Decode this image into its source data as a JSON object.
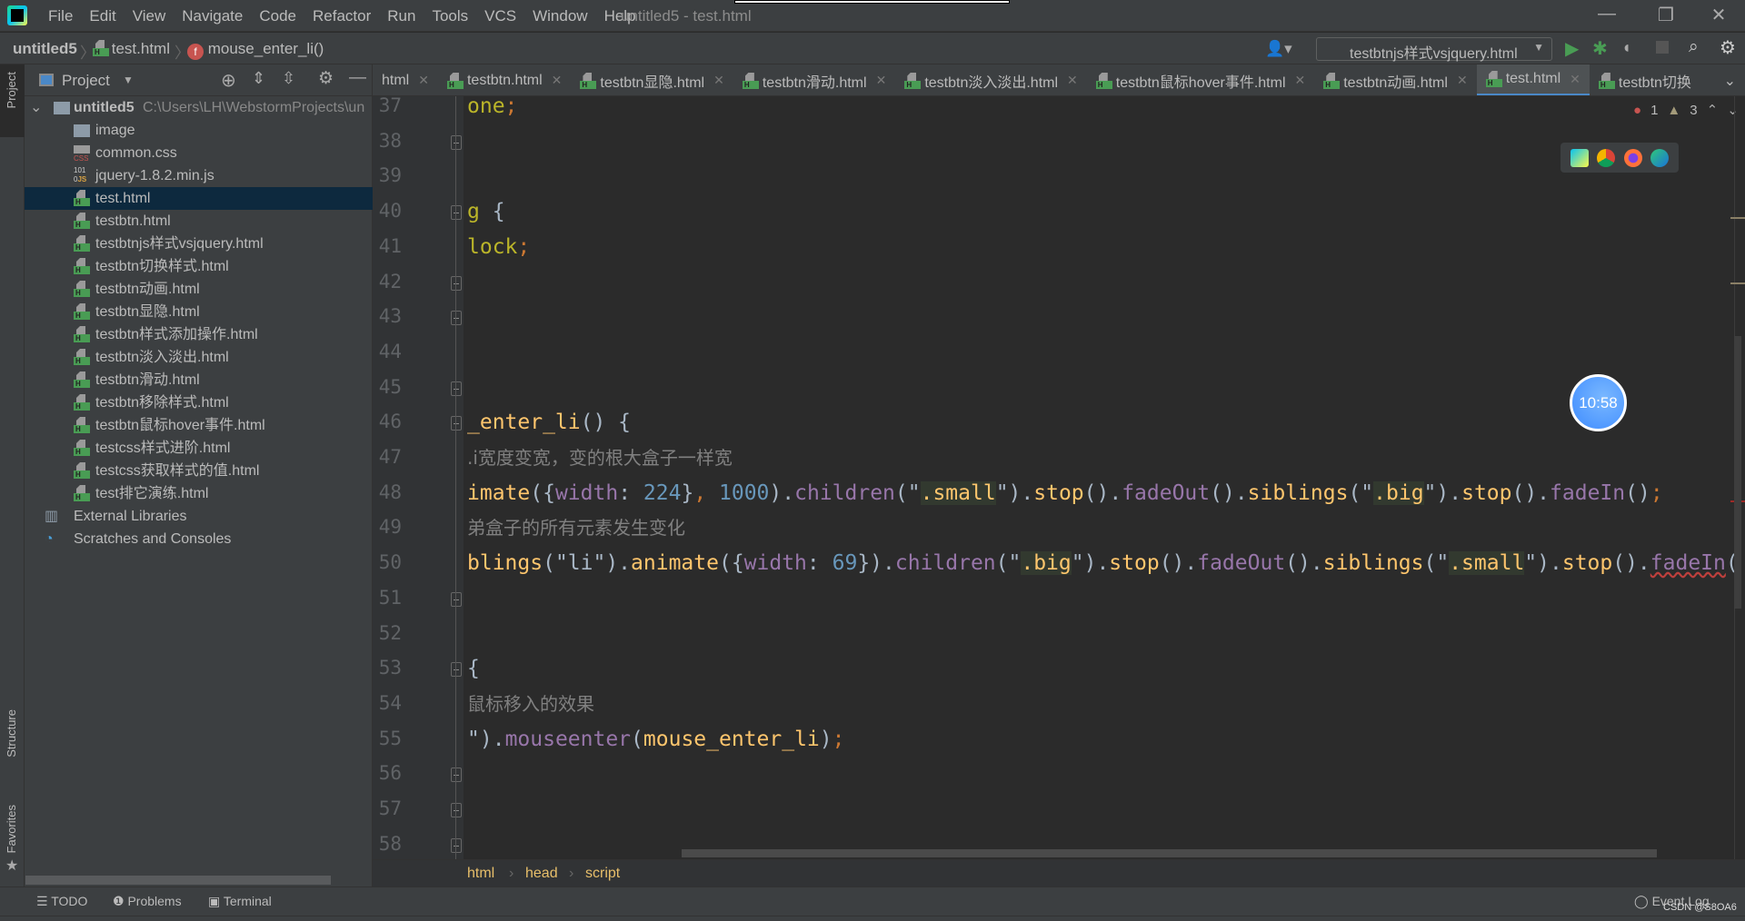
{
  "window": {
    "title": "untitled5 - test.html",
    "minimize": "—",
    "restore": "❐",
    "close": "✕"
  },
  "menu": [
    "File",
    "Edit",
    "View",
    "Navigate",
    "Code",
    "Refactor",
    "Run",
    "Tools",
    "VCS",
    "Window",
    "Help"
  ],
  "navbar": {
    "project": "untitled5",
    "file": "test.html",
    "function": "mouse_enter_li()",
    "run_config": "testbtnjs样式vsjquery.html"
  },
  "project_panel": {
    "title": "Project",
    "root": {
      "name": "untitled5",
      "path": "C:\\Users\\LH\\WebstormProjects\\un"
    },
    "items": [
      {
        "name": "image",
        "type": "folder"
      },
      {
        "name": "common.css",
        "type": "css"
      },
      {
        "name": "jquery-1.8.2.min.js",
        "type": "js"
      },
      {
        "name": "test.html",
        "type": "html",
        "selected": true
      },
      {
        "name": "testbtn.html",
        "type": "html"
      },
      {
        "name": "testbtnjs样式vsjquery.html",
        "type": "html"
      },
      {
        "name": "testbtn切换样式.html",
        "type": "html"
      },
      {
        "name": "testbtn动画.html",
        "type": "html"
      },
      {
        "name": "testbtn显隐.html",
        "type": "html"
      },
      {
        "name": "testbtn样式添加操作.html",
        "type": "html"
      },
      {
        "name": "testbtn淡入淡出.html",
        "type": "html"
      },
      {
        "name": "testbtn滑动.html",
        "type": "html"
      },
      {
        "name": "testbtn移除样式.html",
        "type": "html"
      },
      {
        "name": "testbtn鼠标hover事件.html",
        "type": "html"
      },
      {
        "name": "testcss样式进阶.html",
        "type": "html"
      },
      {
        "name": "testcss获取样式的值.html",
        "type": "html"
      },
      {
        "name": "test排它演练.html",
        "type": "html"
      }
    ],
    "external": "External Libraries",
    "scratches": "Scratches and Consoles"
  },
  "side_tabs": {
    "project": "Project",
    "structure": "Structure",
    "favorites": "Favorites"
  },
  "tabs": [
    {
      "label": "html",
      "active": false
    },
    {
      "label": "testbtn.html",
      "active": false
    },
    {
      "label": "testbtn显隐.html",
      "active": false
    },
    {
      "label": "testbtn滑动.html",
      "active": false
    },
    {
      "label": "testbtn淡入淡出.html",
      "active": false
    },
    {
      "label": "testbtn鼠标hover事件.html",
      "active": false
    },
    {
      "label": "testbtn动画.html",
      "active": false
    },
    {
      "label": "test.html",
      "active": true
    },
    {
      "label": "testbtn切换",
      "active": false
    }
  ],
  "inspections": {
    "errors": "1",
    "warnings": "3"
  },
  "clock": "10:58",
  "editor": {
    "lines": [
      {
        "n": "37",
        "fold": false,
        "t": [
          [
            "one",
            "g"
          ],
          [
            ";",
            "p"
          ]
        ]
      },
      {
        "n": "38",
        "fold": true,
        "t": []
      },
      {
        "n": "39",
        "fold": false,
        "t": []
      },
      {
        "n": "40",
        "fold": true,
        "t": [
          [
            "g",
            "g"
          ],
          [
            " {",
            "k"
          ]
        ]
      },
      {
        "n": "41",
        "fold": false,
        "t": [
          [
            "lock",
            "g"
          ],
          [
            ";",
            "p"
          ]
        ]
      },
      {
        "n": "42",
        "fold": true,
        "t": []
      },
      {
        "n": "43",
        "fold": true,
        "t": []
      },
      {
        "n": "44",
        "fold": false,
        "t": []
      },
      {
        "n": "45",
        "fold": true,
        "t": []
      },
      {
        "n": "46",
        "fold": true,
        "t": [
          [
            "_enter_li",
            "f"
          ],
          [
            "() {",
            "k"
          ]
        ]
      },
      {
        "n": "47",
        "fold": false,
        "t": [
          [
            ".i宽度变宽，变的根大盒子一样宽",
            "c"
          ]
        ]
      },
      {
        "n": "48",
        "fold": false,
        "t": [
          [
            "imate",
            "f"
          ],
          [
            "({",
            "k"
          ],
          [
            "width",
            "m"
          ],
          [
            ": ",
            "k"
          ],
          [
            "224",
            "n"
          ],
          [
            "}",
            "k"
          ],
          [
            ",",
            "p"
          ],
          [
            " 1000",
            "n"
          ],
          [
            ").",
            "k"
          ],
          [
            "children",
            "m"
          ],
          [
            "(\"",
            "k"
          ],
          [
            ".small",
            "s"
          ],
          [
            "\").",
            "k"
          ],
          [
            "stop",
            "f"
          ],
          [
            "().",
            "k"
          ],
          [
            "fadeOut",
            "m"
          ],
          [
            "().",
            "k"
          ],
          [
            "siblings",
            "f"
          ],
          [
            "(\"",
            "k"
          ],
          [
            ".big",
            "s"
          ],
          [
            "\").",
            "k"
          ],
          [
            "stop",
            "f"
          ],
          [
            "().",
            "k"
          ],
          [
            "fadeIn",
            "m"
          ],
          [
            "()",
            "k"
          ],
          [
            ";",
            "p"
          ]
        ]
      },
      {
        "n": "49",
        "fold": false,
        "t": [
          [
            "弟盒子的所有元素发生变化",
            "c"
          ]
        ]
      },
      {
        "n": "50",
        "fold": false,
        "t": [
          [
            "blings",
            "f"
          ],
          [
            "(\"li\").",
            "k"
          ],
          [
            "animate",
            "f"
          ],
          [
            "({",
            "k"
          ],
          [
            "width",
            "m"
          ],
          [
            ": ",
            "k"
          ],
          [
            "69",
            "n"
          ],
          [
            "}).",
            "k"
          ],
          [
            "children",
            "m"
          ],
          [
            "(\"",
            "k"
          ],
          [
            ".big",
            "s"
          ],
          [
            "\").",
            "k"
          ],
          [
            "stop",
            "f"
          ],
          [
            "().",
            "k"
          ],
          [
            "fadeOut",
            "m"
          ],
          [
            "().",
            "k"
          ],
          [
            "siblings",
            "f"
          ],
          [
            "(\"",
            "k"
          ],
          [
            ".small",
            "s"
          ],
          [
            "\").",
            "k"
          ],
          [
            "stop",
            "f"
          ],
          [
            "().",
            "k"
          ],
          [
            "fadeIn",
            "m w"
          ],
          [
            "(",
            "k"
          ]
        ]
      },
      {
        "n": "51",
        "fold": true,
        "t": []
      },
      {
        "n": "52",
        "fold": false,
        "t": []
      },
      {
        "n": "53",
        "fold": true,
        "t": [
          [
            "{",
            "k"
          ]
        ]
      },
      {
        "n": "54",
        "fold": false,
        "t": [
          [
            "鼠标移入的效果",
            "c"
          ]
        ]
      },
      {
        "n": "55",
        "fold": false,
        "t": [
          [
            "\"",
            "k"
          ],
          [
            ").",
            "k"
          ],
          [
            "mouseenter",
            "m"
          ],
          [
            "(",
            "k"
          ],
          [
            "mouse_enter_li",
            "f"
          ],
          [
            ")",
            "k"
          ],
          [
            ";",
            "p"
          ]
        ]
      },
      {
        "n": "56",
        "fold": true,
        "t": []
      },
      {
        "n": "57",
        "fold": true,
        "t": []
      },
      {
        "n": "58",
        "fold": true,
        "t": []
      }
    ]
  },
  "breadcrumb": [
    "html",
    "head",
    "script"
  ],
  "toolwindows": {
    "todo": "TODO",
    "problems": "Problems",
    "terminal": "Terminal",
    "event_log": "Event Log",
    "watermark": "CSDN @S8OA6"
  }
}
